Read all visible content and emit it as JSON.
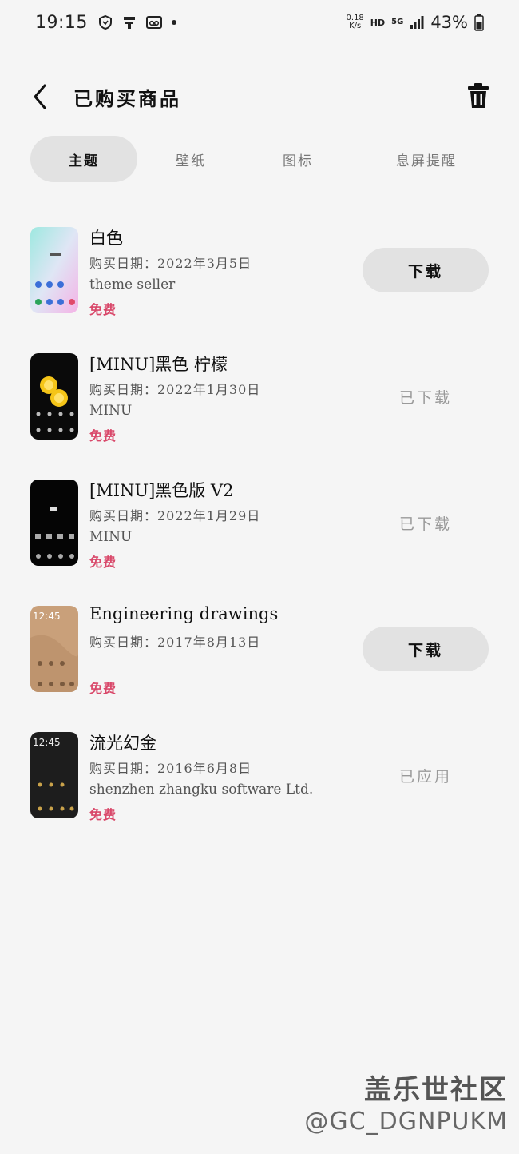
{
  "status_bar": {
    "time": "19:15",
    "net_speed_value": "0.18",
    "net_speed_unit": "K/s",
    "hd": "HD",
    "network": "5G",
    "battery": "43%"
  },
  "header": {
    "title": "已购买商品",
    "back_icon": "chevron-left-icon",
    "delete_icon": "trash-icon"
  },
  "tabs": [
    {
      "label": "主题",
      "active": true
    },
    {
      "label": "壁纸",
      "active": false
    },
    {
      "label": "图标",
      "active": false
    },
    {
      "label": "息屏提醒",
      "active": false
    }
  ],
  "items": [
    {
      "title": "白色",
      "date": "购买日期：2022年3月5日",
      "seller": "theme seller",
      "price": "免费",
      "action": "下载",
      "action_type": "button"
    },
    {
      "title": "[MINU]黑色 柠檬",
      "date": "购买日期：2022年1月30日",
      "seller": "MINU",
      "price": "免费",
      "action": "已下载",
      "action_type": "status"
    },
    {
      "title": "[MINU]黑色版 V2",
      "date": "购买日期：2022年1月29日",
      "seller": "MINU",
      "price": "免费",
      "action": "已下载",
      "action_type": "status"
    },
    {
      "title": "Engineering drawings",
      "date": "购买日期：2017年8月13日",
      "seller": "",
      "price": "免费",
      "action": "下载",
      "action_type": "button",
      "thumb_time": "12:45"
    },
    {
      "title": "流光幻金",
      "date": "购买日期：2016年6月8日",
      "seller": "shenzhen zhangku software Ltd.",
      "price": "免费",
      "action": "已应用",
      "action_type": "status",
      "thumb_time": "12:45"
    }
  ],
  "watermark": {
    "line1": "盖乐世社区",
    "line2": "@GC_DGNPUKM"
  },
  "colors": {
    "background": "#f5f5f5",
    "tab_active_bg": "#e2e2e2",
    "price": "#d9486a",
    "status_text": "#999999"
  }
}
